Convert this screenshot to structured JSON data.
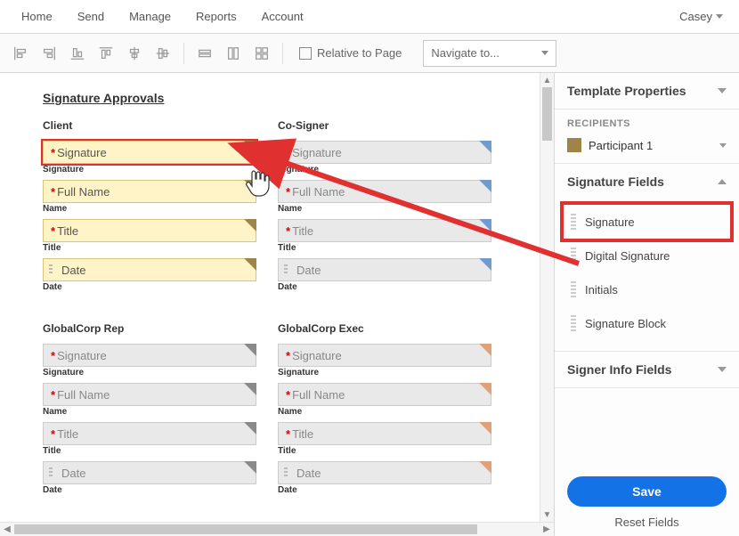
{
  "nav": {
    "items": [
      "Home",
      "Send",
      "Manage",
      "Reports",
      "Account"
    ],
    "user": "Casey"
  },
  "toolbar": {
    "relative_label": "Relative to Page",
    "navigate_label": "Navigate to..."
  },
  "doc": {
    "title": "Signature Approvals",
    "blocks": [
      {
        "title": "Client",
        "variant": "yellow",
        "highlight_sig": true
      },
      {
        "title": "Co-Signer",
        "variant": "blue",
        "highlight_sig": false
      },
      {
        "title": "GlobalCorp Rep",
        "variant": "grey",
        "highlight_sig": false
      },
      {
        "title": "GlobalCorp Exec",
        "variant": "orange",
        "highlight_sig": false
      }
    ],
    "field_labels": {
      "signature_ph": "Signature",
      "signature_lbl": "Signature",
      "fullname_ph": "Full Name",
      "name_lbl": "Name",
      "title_ph": "Title",
      "title_lbl": "Title",
      "date_ph": "Date",
      "date_lbl": "Date"
    }
  },
  "panel": {
    "template_props": "Template Properties",
    "recipients_head": "RECIPIENTS",
    "participant": "Participant 1",
    "sig_fields_head": "Signature Fields",
    "sig_fields": [
      "Signature",
      "Digital Signature",
      "Initials",
      "Signature Block"
    ],
    "signer_info_head": "Signer Info Fields",
    "save": "Save",
    "reset": "Reset Fields"
  }
}
